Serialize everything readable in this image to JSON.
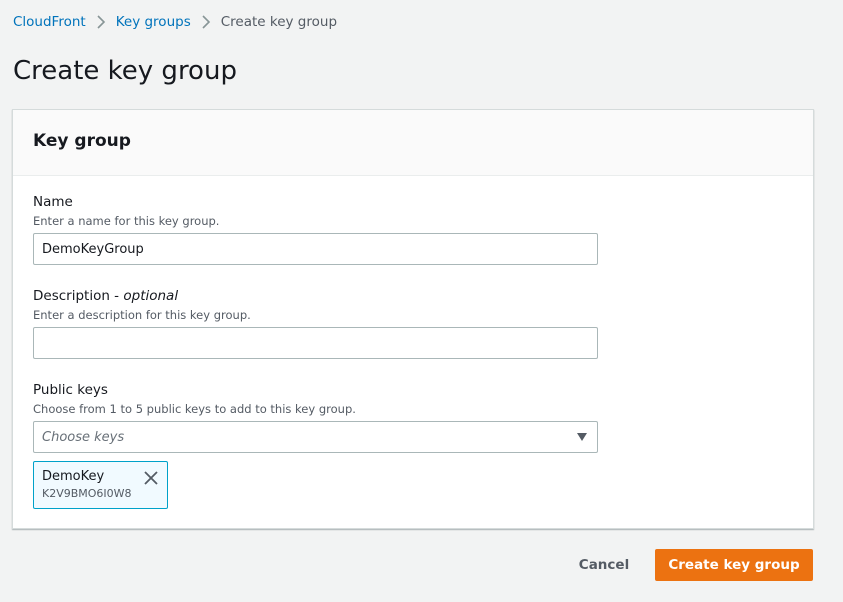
{
  "breadcrumb": {
    "items": [
      "CloudFront",
      "Key groups"
    ],
    "current": "Create key group"
  },
  "page_title": "Create key group",
  "panel": {
    "title": "Key group",
    "name_field": {
      "label": "Name",
      "description": "Enter a name for this key group.",
      "value": "DemoKeyGroup"
    },
    "description_field": {
      "label": "Description",
      "label_suffix": "optional",
      "description": "Enter a description for this key group.",
      "value": ""
    },
    "public_keys_field": {
      "label": "Public keys",
      "description": "Choose from 1 to 5 public keys to add to this key group.",
      "placeholder": "Choose keys",
      "selected_tokens": [
        {
          "name": "DemoKey",
          "id": "K2V9BMO6I0W8"
        }
      ]
    }
  },
  "actions": {
    "cancel_label": "Cancel",
    "create_label": "Create key group"
  },
  "colors": {
    "link": "#0073bb",
    "primary": "#ec7211",
    "token_border": "#00a1c9",
    "background": "#f2f3f3"
  },
  "icons": {
    "breadcrumb_separator": "chevron-right-icon",
    "select_caret": "caret-down-icon",
    "token_remove": "close-icon"
  }
}
